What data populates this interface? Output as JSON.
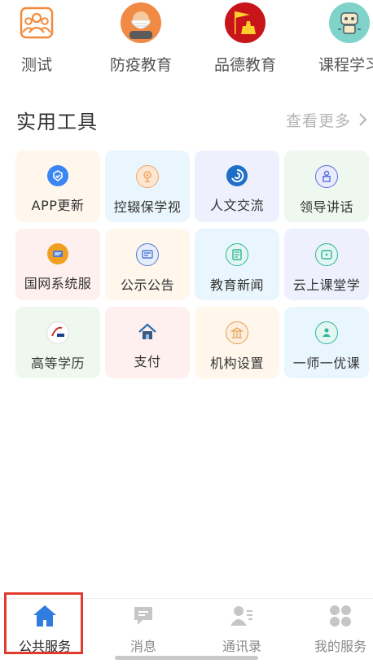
{
  "categories": [
    {
      "label": "测试",
      "icon": "people-icon"
    },
    {
      "label": "防疫教育",
      "icon": "mask-icon"
    },
    {
      "label": "品德教育",
      "icon": "flag-monument-icon"
    },
    {
      "label": "课程学习",
      "icon": "robot-course-icon"
    }
  ],
  "tools_section": {
    "title": "实用工具",
    "more": "查看更多",
    "more_icon": "chevron-right-icon"
  },
  "tools": [
    {
      "label": "APP更新",
      "icon": "app-update-icon",
      "color": "#3b86f5",
      "bg": "#fff6ec"
    },
    {
      "label": "控辍保学视",
      "icon": "location-pin-icon",
      "color": "#f0a860",
      "bg": "#eaf6fd"
    },
    {
      "label": "人文交流",
      "icon": "swirl-icon",
      "color": "#1e6fc7",
      "bg": "#eef0fd"
    },
    {
      "label": "领导讲话",
      "icon": "podium-icon",
      "color": "#5b6ee0",
      "bg": "#eef8ef"
    },
    {
      "label": "国网系统服",
      "icon": "network-service-icon",
      "color": "#f0a020",
      "bg": "#fdf0ee"
    },
    {
      "label": "公示公告",
      "icon": "notice-board-icon",
      "color": "#4f7bd6",
      "bg": "#fff6ec"
    },
    {
      "label": "教育新闻",
      "icon": "newspaper-icon",
      "color": "#2db59a",
      "bg": "#eaf6fd"
    },
    {
      "label": "云上课堂学",
      "icon": "video-play-icon",
      "color": "#2db59a",
      "bg": "#eef0fd"
    },
    {
      "label": "高等学历",
      "icon": "chsi-logo-icon",
      "color": "#d0302a",
      "bg": "#eef8ef"
    },
    {
      "label": "支付",
      "icon": "house-icon",
      "color": "#2e6fb3",
      "bg": "#fdf0ee"
    },
    {
      "label": "机构设置",
      "icon": "institution-icon",
      "color": "#e6a050",
      "bg": "#fff6ec"
    },
    {
      "label": "一师一优课",
      "icon": "teacher-icon",
      "color": "#2db59a",
      "bg": "#eaf6fd"
    }
  ],
  "tabs": [
    {
      "label": "公共服务",
      "icon": "home-icon",
      "active": true
    },
    {
      "label": "消息",
      "icon": "message-icon",
      "active": false
    },
    {
      "label": "通讯录",
      "icon": "contacts-icon",
      "active": false
    },
    {
      "label": "我的服务",
      "icon": "grid-services-icon",
      "active": false
    }
  ],
  "colors": {
    "accent": "#2f7de0",
    "selection_outline": "#e23a2e"
  }
}
